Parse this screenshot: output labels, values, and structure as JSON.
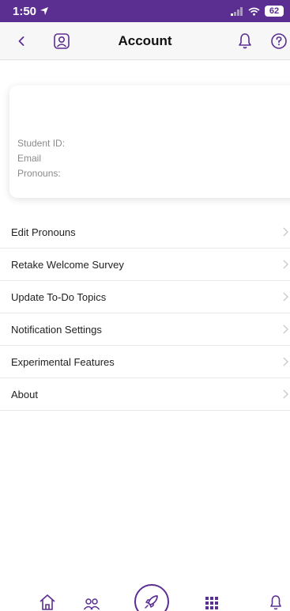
{
  "status_bar": {
    "time": "1:50",
    "battery": "62"
  },
  "header": {
    "title": "Account"
  },
  "profile_card": {
    "student_id_label": "Student ID:",
    "email_label": "Email",
    "pronouns_label": "Pronouns:"
  },
  "menu": {
    "items": [
      {
        "label": "Edit Pronouns"
      },
      {
        "label": "Retake Welcome Survey"
      },
      {
        "label": "Update To-Do Topics"
      },
      {
        "label": "Notification Settings"
      },
      {
        "label": "Experimental Features"
      },
      {
        "label": "About"
      }
    ]
  },
  "colors": {
    "brand": "#5b2e91",
    "header_bg": "#f7f7f8",
    "muted_text": "#8a8a8a"
  },
  "icons": {
    "back": "chevron-left-icon",
    "profile": "profile-badge-icon",
    "bell": "bell-icon",
    "help": "question-circle-icon",
    "home": "home-icon",
    "people": "people-icon",
    "rocket": "rocket-icon",
    "grid": "grid-icon",
    "tab_bell": "bell-icon"
  }
}
